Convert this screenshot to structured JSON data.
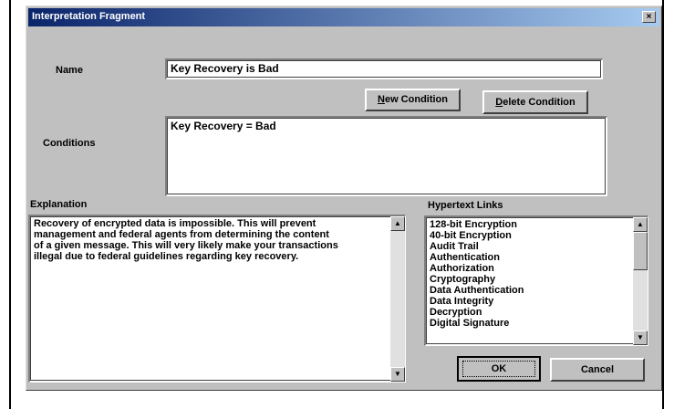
{
  "window": {
    "title": "Interpretation Fragment",
    "close_glyph": "×"
  },
  "name": {
    "label": "Name",
    "value": "Key Recovery is Bad"
  },
  "conditions": {
    "label": "Conditions",
    "value": "Key Recovery = Bad",
    "new_button": {
      "underline": "N",
      "rest": "ew Condition"
    },
    "delete_button": {
      "underline": "D",
      "rest": "elete Condition"
    }
  },
  "explanation": {
    "label": "Explanation",
    "text": "Recovery of encrypted data is impossible. This will prevent\nmanagement and federal agents from determining the content\nof a given message. This will very likely make your transactions\nillegal due to federal guidelines regarding key recovery."
  },
  "hypertext": {
    "label": "Hypertext Links",
    "items": [
      "128-bit Encryption",
      "40-bit Encryption",
      "Audit Trail",
      "Authentication",
      "Authorization",
      "Cryptography",
      "Data Authentication",
      "Data Integrity",
      "Decryption",
      "Digital Signature"
    ]
  },
  "buttons": {
    "ok": "OK",
    "cancel": "Cancel"
  },
  "scroll_arrows": {
    "up": "▲",
    "down": "▼"
  }
}
